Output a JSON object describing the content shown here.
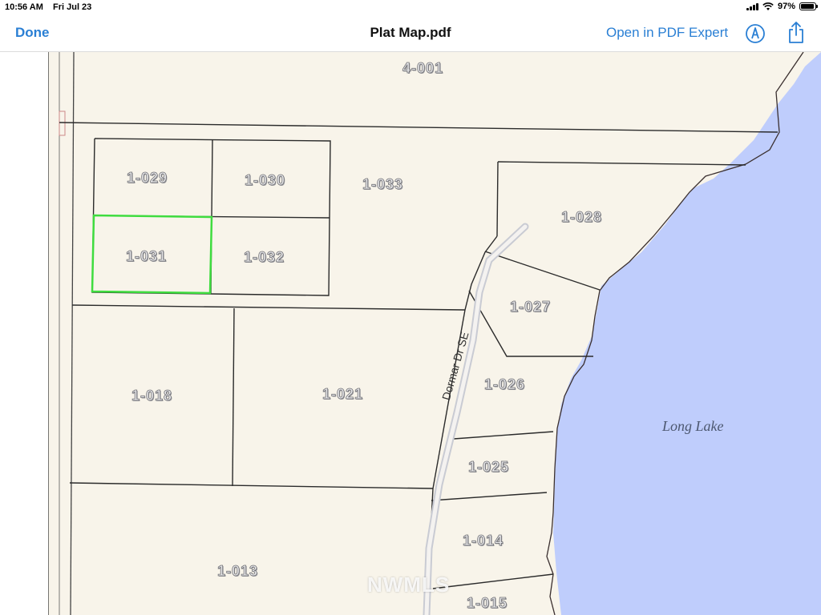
{
  "status_bar": {
    "time": "10:56 AM",
    "date": "Fri Jul 23",
    "battery": "97%",
    "battery_level": 0.97,
    "icons": [
      "cellular-signal-icon",
      "wifi-icon",
      "battery-icon"
    ]
  },
  "nav": {
    "done_label": "Done",
    "title": "Plat Map.pdf",
    "open_label": "Open in PDF Expert",
    "markup_icon": "markup-pen-icon",
    "share_icon": "share-icon",
    "accent_color": "#2a7fd4"
  },
  "map": {
    "lake_color": "#bfcdfc",
    "land_color": "#f8f4ea",
    "highlight_color": "#3fdc3f",
    "parcels": {
      "p4001": "4-001",
      "p1029": "1-029",
      "p1030": "1-030",
      "p1033": "1-033",
      "p1028": "1-028",
      "p1031": "1-031",
      "p1032": "1-032",
      "p1027": "1-027",
      "p1018": "1-018",
      "p1021": "1-021",
      "p1026": "1-026",
      "p1025": "1-025",
      "p1014": "1-014",
      "p1013": "1-013",
      "p1015": "1-015"
    },
    "highlighted_parcel": "1-031",
    "lake_label": "Long Lake",
    "road_label": "Dormar Dr SE",
    "watermark": "NWMLS"
  }
}
